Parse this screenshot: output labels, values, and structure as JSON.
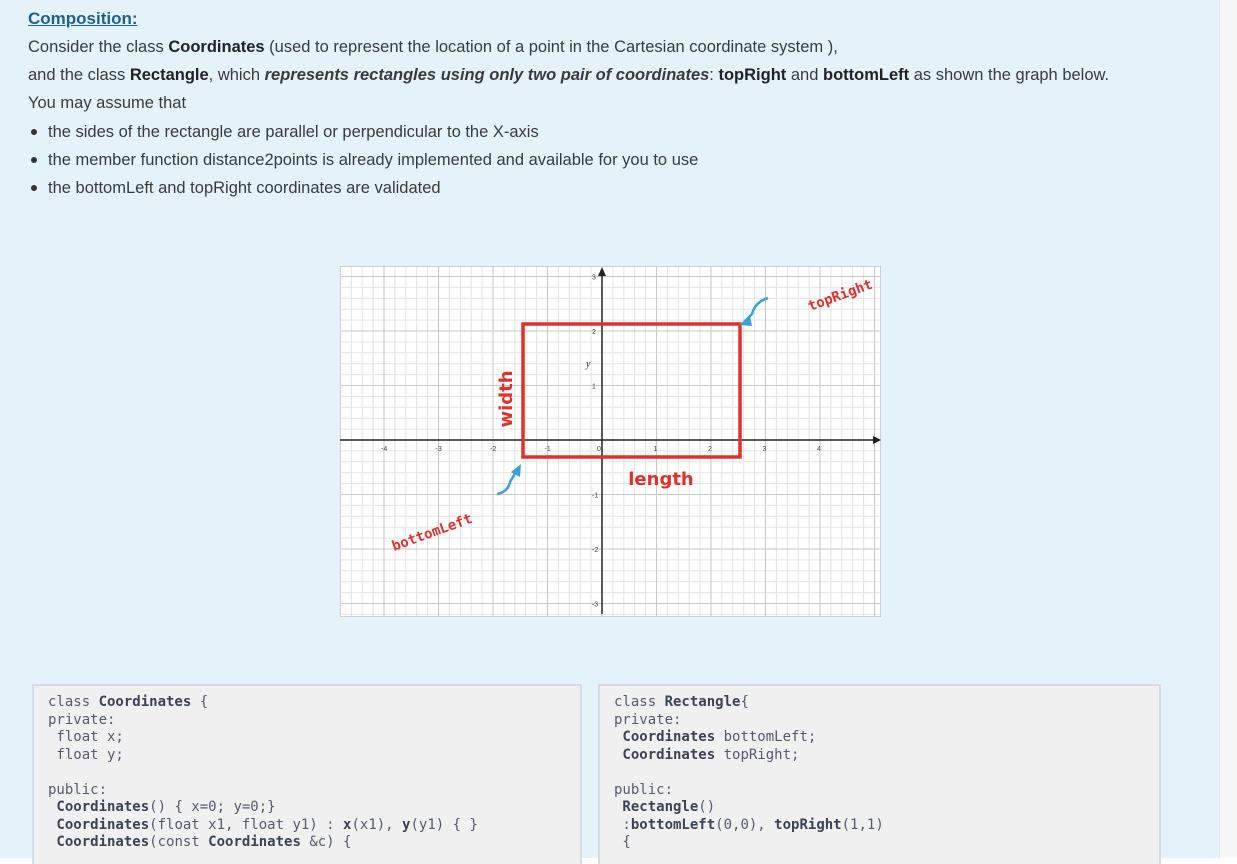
{
  "heading": "Composition:",
  "intro": {
    "line1_pre": "Consider the class ",
    "line1_class": "Coordinates",
    "line1_post": " (used to represent the location of a point in the Cartesian coordinate system ),",
    "line2_pre": "and the class ",
    "line2_class": "Rectangle",
    "line2_mid": ", which ",
    "line2_em": "represents rectangles using only two pair of coordinates",
    "line2_colon": ": ",
    "line2_tr": "topRight",
    "line2_and": " and ",
    "line2_bl": "bottomLeft",
    "line2_post": "  as shown the graph below.",
    "line3": "You may assume that"
  },
  "bullets": [
    "the sides of the rectangle are parallel or perpendicular to the X-axis",
    "the member function distance2points is already implemented and available for you to use",
    "the bottomLeft and topRight coordinates are validated"
  ],
  "figure": {
    "labels": {
      "width": "width",
      "length": "length",
      "topRight": "topRight",
      "bottomLeft": "bottomLeft",
      "y_axis": "y"
    },
    "x_ticks": [
      "-4",
      "-3",
      "-2",
      "-1",
      "0",
      "1",
      "2",
      "3",
      "4"
    ],
    "y_ticks": [
      "3",
      "2",
      "1",
      "-1",
      "-2",
      "-3"
    ],
    "rect_color": "#e0312a",
    "arrow_color": "#3aa0dc"
  },
  "code_left": {
    "l1_kw": "class ",
    "l1_name": "Coordinates",
    "l1_rest": " {",
    "l2": "private:",
    "l3": " float x;",
    "l4": " float y;",
    "l5": "public:",
    "l6_name": " Coordinates",
    "l6_rest": "() { x=0; y=0;}",
    "l7_name": " Coordinates",
    "l7_a": "(float x1, float y1) : ",
    "l7_b": "x",
    "l7_c": "(x1), ",
    "l7_d": "y",
    "l7_e": "(y1) { }",
    "l8_name": " Coordinates",
    "l8_a": "(const ",
    "l8_b": "Coordinates",
    "l8_c": " &c) {"
  },
  "code_right": {
    "l1_kw": "class ",
    "l1_name": "Rectangle",
    "l1_rest": "{",
    "l2": "private:",
    "l3_type": " Coordinates",
    "l3_rest": " bottomLeft;",
    "l4_type": " Coordinates",
    "l4_rest": " topRight;",
    "l5": "public:",
    "l6_name": " Rectangle",
    "l6_rest": "()",
    "l7_a": " :",
    "l7_b": "bottomLeft",
    "l7_c": "(0,0), ",
    "l7_d": "topRight",
    "l7_e": "(1,1)",
    "l8": " {"
  }
}
